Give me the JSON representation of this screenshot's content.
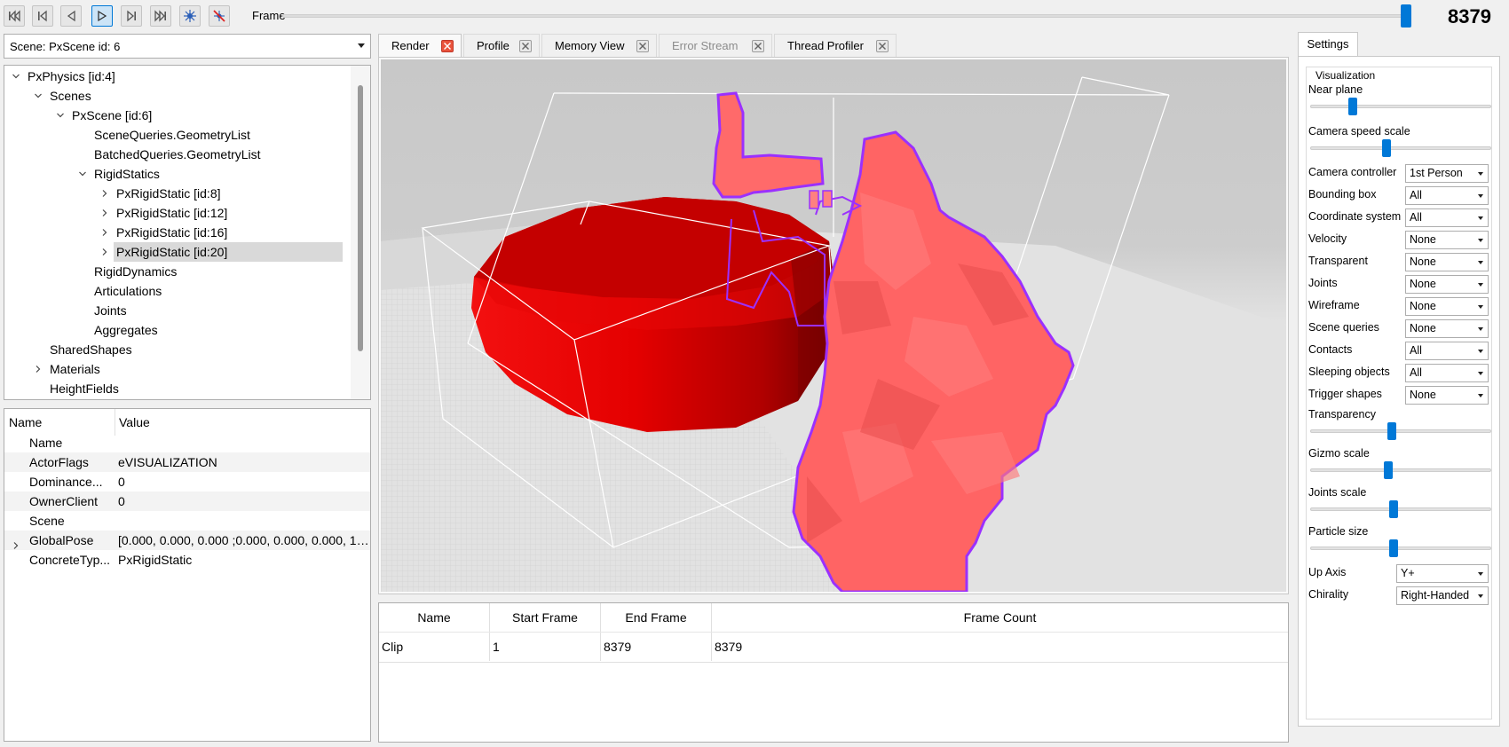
{
  "toolbar": {
    "frame_label": "Frame",
    "frame_value": "8379",
    "frame_slider_fraction": 1.0,
    "buttons": [
      {
        "name": "first-frame-button",
        "icon": "skip-to-start-icon"
      },
      {
        "name": "previous-key-button",
        "icon": "step-back-icon"
      },
      {
        "name": "step-back-button",
        "icon": "play-reverse-icon"
      },
      {
        "name": "play-button",
        "icon": "play-icon"
      },
      {
        "name": "step-forward-button",
        "icon": "step-forward-icon"
      },
      {
        "name": "last-frame-button",
        "icon": "skip-to-end-icon"
      },
      {
        "name": "connect-button",
        "icon": "burst-icon"
      },
      {
        "name": "disconnect-button",
        "icon": "disconnect-icon"
      }
    ]
  },
  "scene_selector": {
    "value": "Scene: PxScene id: 6"
  },
  "tree": {
    "items": [
      {
        "label": "PxPhysics [id:4]",
        "expander": "open"
      },
      {
        "label": "Scenes",
        "expander": "open"
      },
      {
        "label": "PxScene [id:6]",
        "expander": "open"
      },
      {
        "label": "SceneQueries.GeometryList",
        "expander": "none"
      },
      {
        "label": "BatchedQueries.GeometryList",
        "expander": "none"
      },
      {
        "label": "RigidStatics",
        "expander": "open"
      },
      {
        "label": "PxRigidStatic [id:8]",
        "expander": "closed"
      },
      {
        "label": "PxRigidStatic [id:12]",
        "expander": "closed"
      },
      {
        "label": "PxRigidStatic [id:16]",
        "expander": "closed"
      },
      {
        "label": "PxRigidStatic [id:20]",
        "expander": "closed"
      },
      {
        "label": "RigidDynamics",
        "expander": "none"
      },
      {
        "label": "Articulations",
        "expander": "none"
      },
      {
        "label": "Joints",
        "expander": "none"
      },
      {
        "label": "Aggregates",
        "expander": "none"
      },
      {
        "label": "SharedShapes",
        "expander": "none"
      },
      {
        "label": "Materials",
        "expander": "closed"
      },
      {
        "label": "HeightFields",
        "expander": "none"
      }
    ],
    "selected_label": "PxRigidStatic [id:20]"
  },
  "properties": {
    "headers": {
      "name": "Name",
      "value": "Value"
    },
    "rows": [
      {
        "name": "Name",
        "value": ""
      },
      {
        "name": "ActorFlags",
        "value": "eVISUALIZATION"
      },
      {
        "name": "Dominance...",
        "value": "0"
      },
      {
        "name": "OwnerClient",
        "value": "0"
      },
      {
        "name": "Scene",
        "value": ""
      },
      {
        "name": "GlobalPose",
        "value": "[0.000, 0.000, 0.000 ;0.000, 0.000, 0.000, 1...."
      },
      {
        "name": "ConcreteTyp...",
        "value": "PxRigidStatic"
      }
    ]
  },
  "tabs": [
    {
      "label": "Render",
      "active": true,
      "enabled": true
    },
    {
      "label": "Profile",
      "active": false,
      "enabled": true
    },
    {
      "label": "Memory View",
      "active": false,
      "enabled": true
    },
    {
      "label": "Error Stream",
      "active": false,
      "enabled": false
    },
    {
      "label": "Thread Profiler",
      "active": false,
      "enabled": true
    }
  ],
  "clips": {
    "headers": [
      "Name",
      "Start Frame",
      "End Frame",
      "Frame Count"
    ],
    "rows": [
      {
        "name": "Clip",
        "start": "1",
        "end": "8379",
        "count": "8379"
      }
    ]
  },
  "settings": {
    "tab_label": "Settings",
    "group_title": "Visualization",
    "near_plane": {
      "label": "Near plane",
      "value": 0.22
    },
    "camera_speed": {
      "label": "Camera speed scale",
      "value": 0.42
    },
    "combos": [
      {
        "label": "Camera controller",
        "value": "1st Person"
      },
      {
        "label": "Bounding box",
        "value": "All"
      },
      {
        "label": "Coordinate system",
        "value": "All"
      },
      {
        "label": "Velocity",
        "value": "None"
      },
      {
        "label": "Transparent",
        "value": "None"
      },
      {
        "label": "Joints",
        "value": "None"
      },
      {
        "label": "Wireframe",
        "value": "None"
      },
      {
        "label": "Scene queries",
        "value": "None"
      },
      {
        "label": "Contacts",
        "value": "All"
      },
      {
        "label": "Sleeping objects",
        "value": "All"
      },
      {
        "label": "Trigger shapes",
        "value": "None"
      }
    ],
    "transparency": {
      "label": "Transparency",
      "value": 0.45
    },
    "gizmo_scale": {
      "label": "Gizmo scale",
      "value": 0.43
    },
    "joints_scale": {
      "label": "Joints scale",
      "value": 0.46
    },
    "particle_size": {
      "label": "Particle size",
      "value": 0.46
    },
    "up_axis": {
      "label": "Up Axis",
      "value": "Y+"
    },
    "chirality": {
      "label": "Chirality",
      "value": "Right-Handed"
    }
  },
  "colors": {
    "accent": "#0078d7",
    "selected_row": "#d9d9d9",
    "cylinder_red": "#e00000",
    "mesh_pink": "#ff6262",
    "outline_purple": "#9b30ff"
  }
}
